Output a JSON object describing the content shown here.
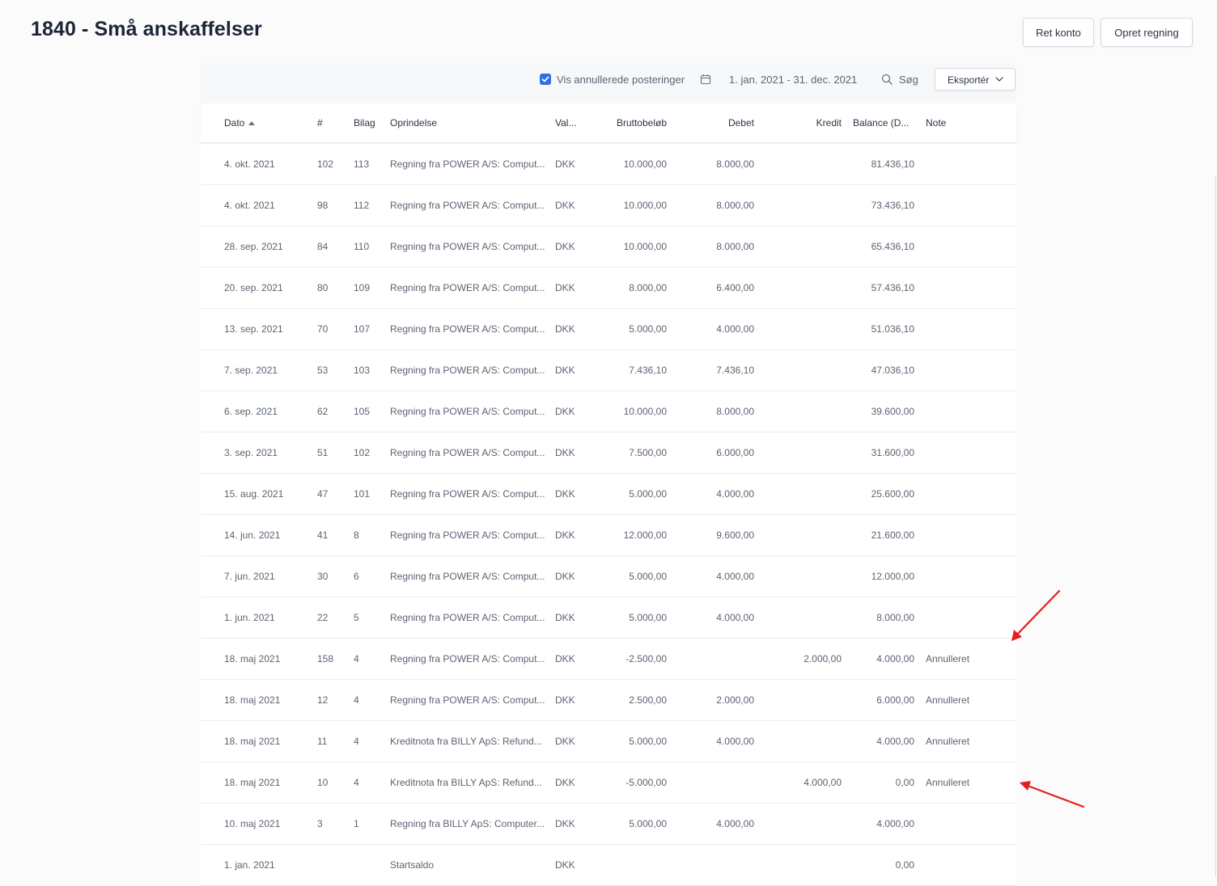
{
  "page": {
    "title": "1840 - Små anskaffelser"
  },
  "header_buttons": {
    "edit_account": "Ret konto",
    "create_bill": "Opret regning"
  },
  "toolbar": {
    "show_voided_label": "Vis annullerede posteringer",
    "show_voided_checked": true,
    "date_range": "1. jan. 2021 - 31. dec. 2021",
    "search_label": "Søg",
    "export_label": "Eksportér",
    "accent_color": "#2f6fe4"
  },
  "table": {
    "columns": {
      "date": "Dato",
      "number": "#",
      "bilag": "Bilag",
      "origin": "Oprindelse",
      "currency": "Val...",
      "gross": "Bruttobeløb",
      "debit": "Debet",
      "credit": "Kredit",
      "balance": "Balance (D...",
      "note": "Note"
    },
    "sort": {
      "column": "date",
      "direction": "ascending",
      "icon": "sort-up-triangle-icon"
    },
    "rows": [
      {
        "date": "4. okt. 2021",
        "number": "102",
        "bilag": "113",
        "origin": "Regning fra POWER A/S: Comput...",
        "currency": "DKK",
        "gross": "10.000,00",
        "debit": "8.000,00",
        "credit": "",
        "balance": "81.436,10",
        "note": ""
      },
      {
        "date": "4. okt. 2021",
        "number": "98",
        "bilag": "112",
        "origin": "Regning fra POWER A/S: Comput...",
        "currency": "DKK",
        "gross": "10.000,00",
        "debit": "8.000,00",
        "credit": "",
        "balance": "73.436,10",
        "note": ""
      },
      {
        "date": "28. sep. 2021",
        "number": "84",
        "bilag": "110",
        "origin": "Regning fra POWER A/S: Comput...",
        "currency": "DKK",
        "gross": "10.000,00",
        "debit": "8.000,00",
        "credit": "",
        "balance": "65.436,10",
        "note": ""
      },
      {
        "date": "20. sep. 2021",
        "number": "80",
        "bilag": "109",
        "origin": "Regning fra POWER A/S: Comput...",
        "currency": "DKK",
        "gross": "8.000,00",
        "debit": "6.400,00",
        "credit": "",
        "balance": "57.436,10",
        "note": ""
      },
      {
        "date": "13. sep. 2021",
        "number": "70",
        "bilag": "107",
        "origin": "Regning fra POWER A/S: Comput...",
        "currency": "DKK",
        "gross": "5.000,00",
        "debit": "4.000,00",
        "credit": "",
        "balance": "51.036,10",
        "note": ""
      },
      {
        "date": "7. sep. 2021",
        "number": "53",
        "bilag": "103",
        "origin": "Regning fra POWER A/S: Comput...",
        "currency": "DKK",
        "gross": "7.436,10",
        "debit": "7.436,10",
        "credit": "",
        "balance": "47.036,10",
        "note": ""
      },
      {
        "date": "6. sep. 2021",
        "number": "62",
        "bilag": "105",
        "origin": "Regning fra POWER A/S: Comput...",
        "currency": "DKK",
        "gross": "10.000,00",
        "debit": "8.000,00",
        "credit": "",
        "balance": "39.600,00",
        "note": ""
      },
      {
        "date": "3. sep. 2021",
        "number": "51",
        "bilag": "102",
        "origin": "Regning fra POWER A/S: Comput...",
        "currency": "DKK",
        "gross": "7.500,00",
        "debit": "6.000,00",
        "credit": "",
        "balance": "31.600,00",
        "note": ""
      },
      {
        "date": "15. aug. 2021",
        "number": "47",
        "bilag": "101",
        "origin": "Regning fra POWER A/S: Comput...",
        "currency": "DKK",
        "gross": "5.000,00",
        "debit": "4.000,00",
        "credit": "",
        "balance": "25.600,00",
        "note": ""
      },
      {
        "date": "14. jun. 2021",
        "number": "41",
        "bilag": "8",
        "origin": "Regning fra POWER A/S: Comput...",
        "currency": "DKK",
        "gross": "12.000,00",
        "debit": "9.600,00",
        "credit": "",
        "balance": "21.600,00",
        "note": ""
      },
      {
        "date": "7. jun. 2021",
        "number": "30",
        "bilag": "6",
        "origin": "Regning fra POWER A/S: Comput...",
        "currency": "DKK",
        "gross": "5.000,00",
        "debit": "4.000,00",
        "credit": "",
        "balance": "12.000,00",
        "note": ""
      },
      {
        "date": "1. jun. 2021",
        "number": "22",
        "bilag": "5",
        "origin": "Regning fra POWER A/S: Comput...",
        "currency": "DKK",
        "gross": "5.000,00",
        "debit": "4.000,00",
        "credit": "",
        "balance": "8.000,00",
        "note": ""
      },
      {
        "date": "18. maj 2021",
        "number": "158",
        "bilag": "4",
        "origin": "Regning fra POWER A/S: Comput...",
        "currency": "DKK",
        "gross": "-2.500,00",
        "debit": "",
        "credit": "2.000,00",
        "balance": "4.000,00",
        "note": "Annulleret"
      },
      {
        "date": "18. maj 2021",
        "number": "12",
        "bilag": "4",
        "origin": "Regning fra POWER A/S: Comput...",
        "currency": "DKK",
        "gross": "2.500,00",
        "debit": "2.000,00",
        "credit": "",
        "balance": "6.000,00",
        "note": "Annulleret"
      },
      {
        "date": "18. maj 2021",
        "number": "11",
        "bilag": "4",
        "origin": "Kreditnota fra BILLY ApS: Refund...",
        "currency": "DKK",
        "gross": "5.000,00",
        "debit": "4.000,00",
        "credit": "",
        "balance": "4.000,00",
        "note": "Annulleret"
      },
      {
        "date": "18. maj 2021",
        "number": "10",
        "bilag": "4",
        "origin": "Kreditnota fra BILLY ApS: Refund...",
        "currency": "DKK",
        "gross": "-5.000,00",
        "debit": "",
        "credit": "4.000,00",
        "balance": "0,00",
        "note": "Annulleret"
      },
      {
        "date": "10. maj 2021",
        "number": "3",
        "bilag": "1",
        "origin": "Regning fra BILLY ApS: Computer...",
        "currency": "DKK",
        "gross": "5.000,00",
        "debit": "4.000,00",
        "credit": "",
        "balance": "4.000,00",
        "note": ""
      },
      {
        "date": "1. jan. 2021",
        "number": "",
        "bilag": "",
        "origin": "Startsaldo",
        "currency": "DKK",
        "gross": "",
        "debit": "",
        "credit": "",
        "balance": "0,00",
        "note": ""
      }
    ]
  },
  "annotations": {
    "arrow_color": "#e41e1e"
  }
}
